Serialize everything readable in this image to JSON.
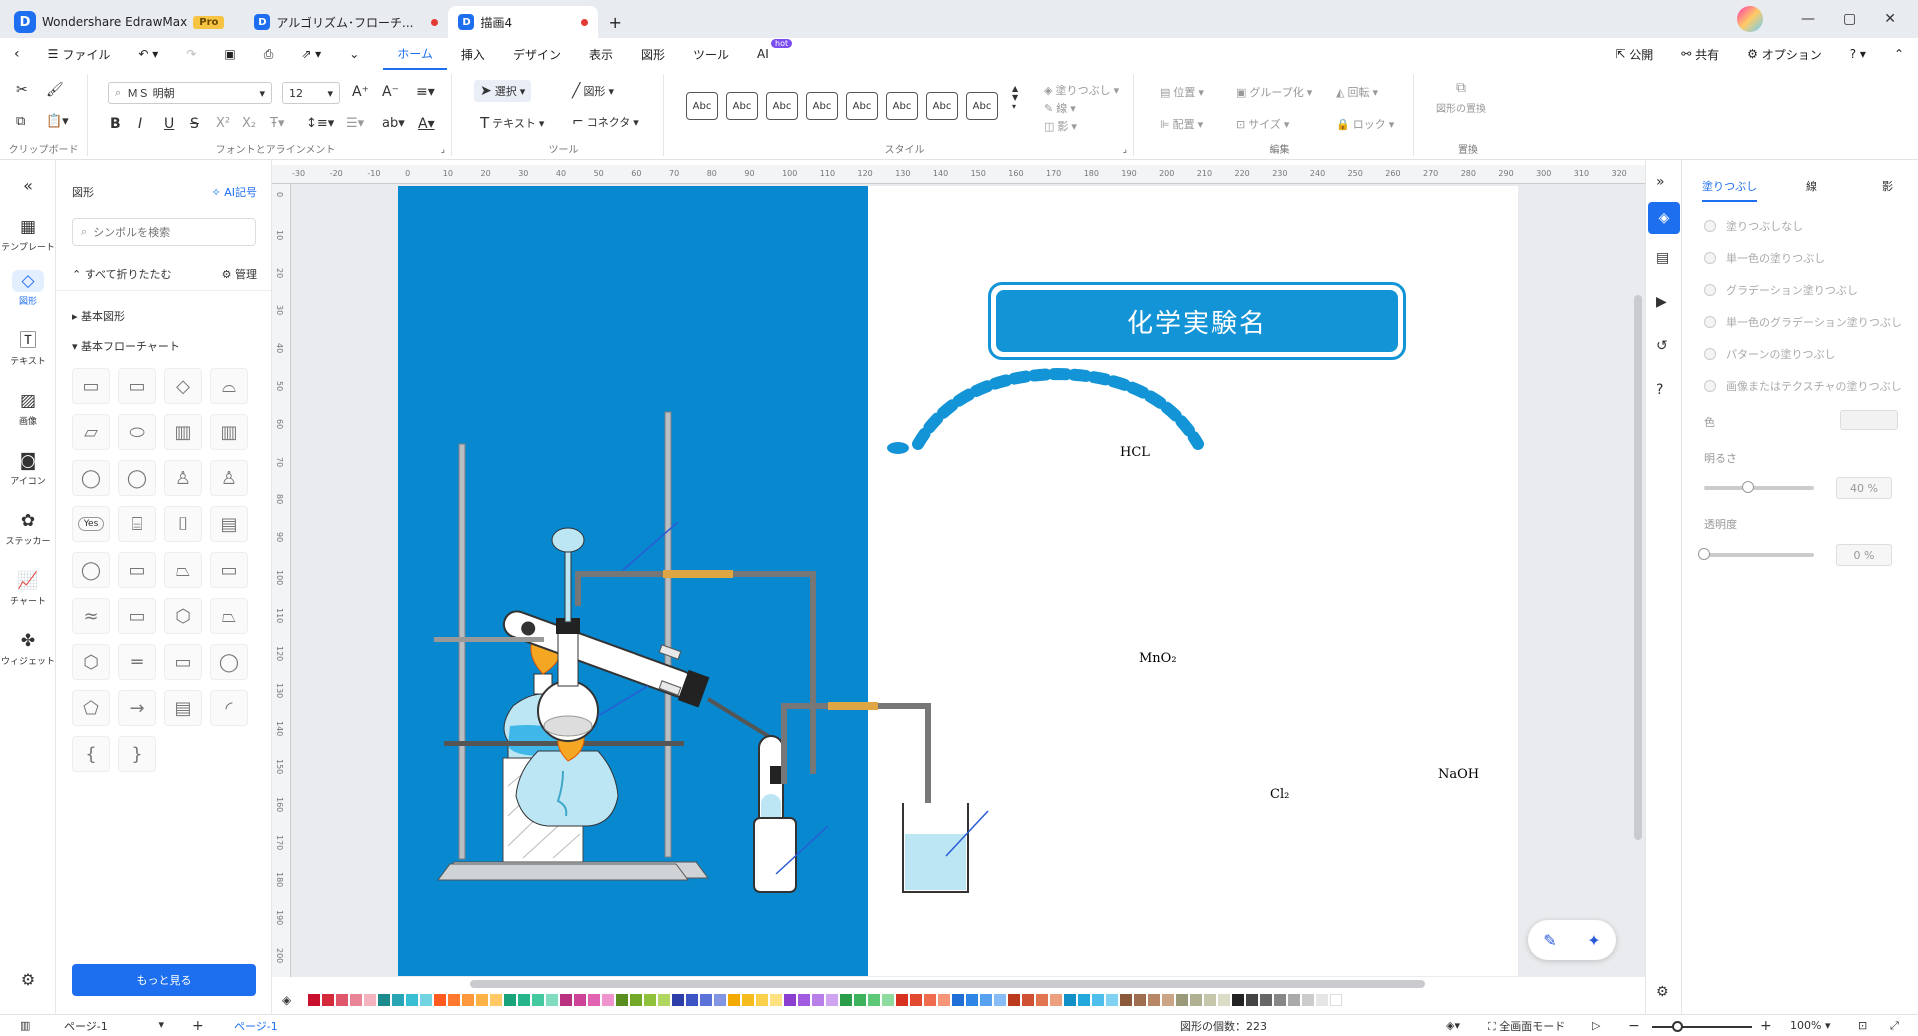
{
  "app": {
    "name": "Wondershare EdrawMax",
    "badge": "Pro"
  },
  "tabs": [
    {
      "label": "アルゴリズム･フローチ..."
    },
    {
      "label": "描画4"
    }
  ],
  "window": {
    "minimize": "—",
    "restore": "▢",
    "close": "✕"
  },
  "menu": {
    "file": "ファイル",
    "items": [
      "ホーム",
      "挿入",
      "デザイン",
      "表示",
      "図形",
      "ツール",
      "AI"
    ],
    "ai_badge": "hot",
    "right": [
      "公開",
      "共有",
      "オプション"
    ]
  },
  "ribbon": {
    "clipboard_label": "クリップボード",
    "font_label": "フォントとアラインメント",
    "font_name": "ＭＳ 明朝",
    "font_size": "12",
    "tools_label": "ツール",
    "select": "選択",
    "shape": "図形",
    "text": "テキスト",
    "connector": "コネクタ",
    "style_label": "スタイル",
    "style_swatch": "Abc",
    "fill": "塗りつぶし",
    "line": "線",
    "shadow": "影",
    "edit_label": "編集",
    "position": "位置",
    "group": "グループ化",
    "rotate": "回転",
    "align": "配置",
    "size": "サイズ",
    "lock": "ロック",
    "replace_label": "置換",
    "replace_shape": "図形の置換"
  },
  "leftrail": [
    "テンプレート",
    "図形",
    "テキスト",
    "画像",
    "アイコン",
    "ステッカー",
    "チャート",
    "ウィジェット"
  ],
  "shapes_panel": {
    "title": "図形",
    "ai_symbol": "AI記号",
    "search_placeholder": "シンボルを検索",
    "collapse_all": "すべて折りたたむ",
    "manage": "管理",
    "basic_shapes": "基本図形",
    "basic_flowchart": "基本フローチャート",
    "yes_shape": "Yes",
    "more": "もっと見る"
  },
  "ruler": {
    "h": [
      "-30",
      "-20",
      "-10",
      "0",
      "10",
      "20",
      "30",
      "40",
      "50",
      "60",
      "70",
      "80",
      "90",
      "100",
      "110",
      "120",
      "130",
      "140",
      "150",
      "160",
      "170",
      "180",
      "190",
      "200",
      "210",
      "220",
      "230",
      "240",
      "250",
      "260",
      "270",
      "280",
      "290",
      "300",
      "310",
      "320"
    ],
    "v": [
      "0",
      "10",
      "20",
      "30",
      "40",
      "50",
      "60",
      "70",
      "80",
      "90",
      "100",
      "110",
      "120",
      "130",
      "140",
      "150",
      "160",
      "170",
      "180",
      "190",
      "200"
    ]
  },
  "canvas": {
    "title": "化学実験名",
    "labels": {
      "hcl": "HCL",
      "mno2": "MnO₂",
      "cl2": "Cl₂",
      "naoh": "NaOH"
    }
  },
  "right_panel": {
    "tabs": [
      "塗りつぶし",
      "線",
      "影"
    ],
    "options": [
      "塗りつぶしなし",
      "単一色の塗りつぶし",
      "グラデーション塗りつぶし",
      "単一色のグラデーション塗りつぶし",
      "パターンの塗りつぶし",
      "画像またはテクスチャの塗りつぶし"
    ],
    "color_label": "色",
    "brightness_label": "明るさ",
    "brightness_value": "40 %",
    "brightness": 0.4,
    "transparency_label": "透明度",
    "transparency_value": "0 %",
    "transparency": 0
  },
  "palette": [
    "#c8102e",
    "#d6293e",
    "#e0566a",
    "#ea8597",
    "#f4b3bf",
    "#1c8b8b",
    "#27a5b5",
    "#39bfd4",
    "#72d3e3",
    "#ff5a1f",
    "#ff7a2f",
    "#ff9a3c",
    "#ffb347",
    "#ffc966",
    "#1aa37a",
    "#26b58b",
    "#42c9a0",
    "#7fdcc0",
    "#b83280",
    "#cc4599",
    "#e062b1",
    "#ef94cc",
    "#5a8f1f",
    "#73a828",
    "#90c13a",
    "#b1d65e",
    "#2d3ea8",
    "#3d55c4",
    "#5b73d8",
    "#8396e6",
    "#f2a900",
    "#f7bd1e",
    "#fbd14b",
    "#fde27f",
    "#8a3fd1",
    "#a25be0",
    "#b87eea",
    "#cfa5f2",
    "#2c9e4b",
    "#3cb35c",
    "#5fc878",
    "#8edc9f",
    "#d6321f",
    "#e44a30",
    "#ef6d4e",
    "#f69679",
    "#1f6fd6",
    "#2f86e8",
    "#57a1f0",
    "#86bdf5",
    "#ba3a1e",
    "#cf5233",
    "#e0754f",
    "#eba17f",
    "#1490c8",
    "#23a8de",
    "#4dbfea",
    "#7fd3f1",
    "#8b5a3c",
    "#a06f4f",
    "#b78866",
    "#cca586",
    "#9a9a7a",
    "#b0b092",
    "#c6c6ab",
    "#dcdcc8",
    "#222222",
    "#444444",
    "#666666",
    "#888888",
    "#aaaaaa",
    "#cccccc",
    "#e6e6e6",
    "#ffffff"
  ],
  "status": {
    "page_select": "ページ-1",
    "page_tab": "ページ-1",
    "shape_count": "図形の個数：223",
    "fullscreen": "全画面モード",
    "zoom": "100%"
  }
}
